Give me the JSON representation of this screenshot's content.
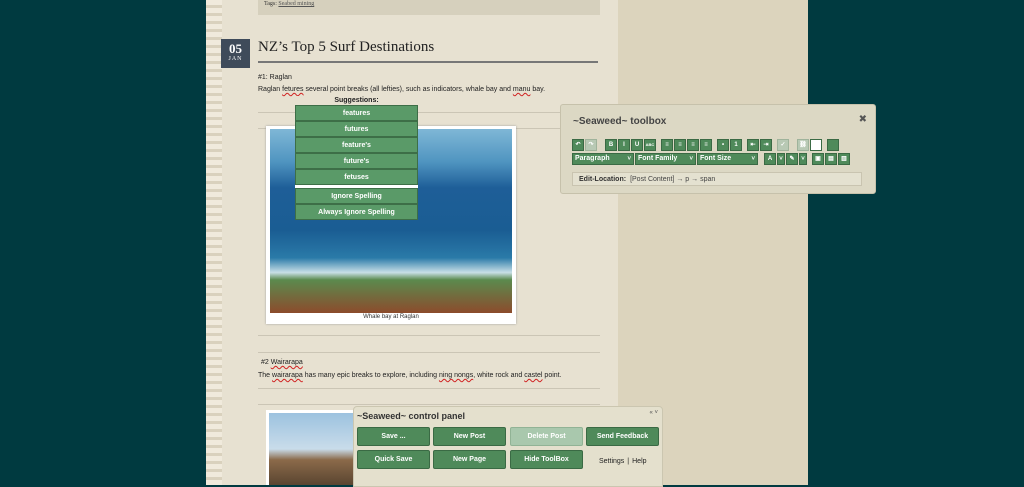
{
  "tags": {
    "label": "Tags:",
    "link": "Seabed mining"
  },
  "post": {
    "date_day": "05",
    "date_month": "JAN",
    "title": "NZ’s Top 5 Surf Destinations",
    "section1_heading": "#1: Raglan",
    "section1_pre": "Raglan ",
    "section1_word": "fetures",
    "section1_post": " several point breaks (all lefties), such as indicators, whale bay and ",
    "section1_word2": "manu",
    "section1_end": " bay.",
    "photo1_caption": "Whale bay at Raglan",
    "section2_num": "#2 ",
    "section2_word": "Wairarapa",
    "section2_p1": "The ",
    "section2_w1": "wairarapa",
    "section2_p2": " has many epic breaks to explore, including ",
    "section2_w2": "ning nongs",
    "section2_p3": ", white rock and ",
    "section2_w3": "castel",
    "section2_p4": " point."
  },
  "spell_menu": {
    "header": "Suggestions:",
    "suggestions": [
      "features",
      "futures",
      "feature's",
      "future's",
      "fetuses"
    ],
    "ignore": "Ignore Spelling",
    "always_ignore": "Always Ignore Spelling"
  },
  "toolbox": {
    "title": "~Seaweed~ toolbox",
    "close_glyph": "✖",
    "format_select": "Paragraph",
    "font_family_select": "Font Family",
    "font_size_select": "Font Size",
    "edit_location_label": "Edit-Location:",
    "edit_location_value": "[Post Content] → p → span",
    "bold": "B",
    "italic": "I",
    "underline": "U",
    "strike": "ABC"
  },
  "control_panel": {
    "title": "~Seaweed~ control panel",
    "controls": "« ˅",
    "buttons": [
      "Save ...",
      "New Post",
      "Delete Post",
      "Send Feedback",
      "Quick Save",
      "New Page",
      "Hide ToolBox"
    ],
    "settings": "Settings",
    "help": "Help",
    "divider": "|"
  },
  "colors": {
    "accent_green": "#4f8a5a",
    "background": "#003a40"
  }
}
